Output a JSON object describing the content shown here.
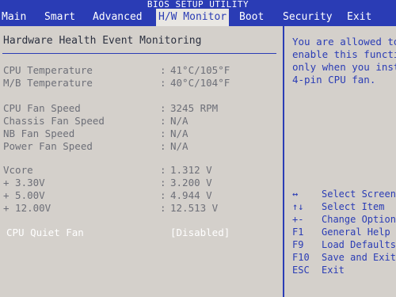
{
  "title": "BIOS SETUP UTILITY",
  "menu": [
    {
      "label": "Main"
    },
    {
      "label": "Smart"
    },
    {
      "label": "Advanced"
    },
    {
      "label": "H/W Monitor"
    },
    {
      "label": "Boot"
    },
    {
      "label": "Security"
    },
    {
      "label": "Exit"
    }
  ],
  "section_title": "Hardware Health Event Monitoring",
  "rows": [
    {
      "label": "CPU Temperature",
      "colon": ":",
      "value": "41°C/105°F"
    },
    {
      "label": "M/B Temperature",
      "colon": ":",
      "value": "40°C/104°F"
    },
    {
      "label": "CPU Fan Speed",
      "colon": ":",
      "value": "3245 RPM"
    },
    {
      "label": "Chassis Fan Speed",
      "colon": ":",
      "value": "N/A"
    },
    {
      "label": "NB Fan Speed",
      "colon": ":",
      "value": "N/A"
    },
    {
      "label": "Power Fan Speed",
      "colon": ":",
      "value": "N/A"
    },
    {
      "label": "Vcore",
      "colon": ":",
      "value": "1.312 V"
    },
    {
      "label": "+ 3.30V",
      "colon": ":",
      "value": "3.200 V"
    },
    {
      "label": "+ 5.00V",
      "colon": ":",
      "value": "4.944 V"
    },
    {
      "label": "+ 12.00V",
      "colon": ":",
      "value": "12.513 V"
    }
  ],
  "selected_row": {
    "label": "CPU Quiet Fan",
    "value": "[Disabled]"
  },
  "help_lines": [
    "You are allowed to",
    "enable this functio",
    "only when you insta",
    "4-pin CPU fan."
  ],
  "keys": [
    {
      "key": "↔",
      "desc": "Select Screen"
    },
    {
      "key": "↑↓",
      "desc": "Select Item"
    },
    {
      "key": "+-",
      "desc": "Change Option"
    },
    {
      "key": "F1",
      "desc": "General Help"
    },
    {
      "key": "F9",
      "desc": "Load Defaults"
    },
    {
      "key": "F10",
      "desc": "Save and Exit"
    },
    {
      "key": "ESC",
      "desc": "Exit"
    }
  ],
  "colors": {
    "blue": "#2a3cb5",
    "panel_background": "#d4d0cb",
    "muted_text": "#6d6f78",
    "selected_text": "#ffffff"
  }
}
